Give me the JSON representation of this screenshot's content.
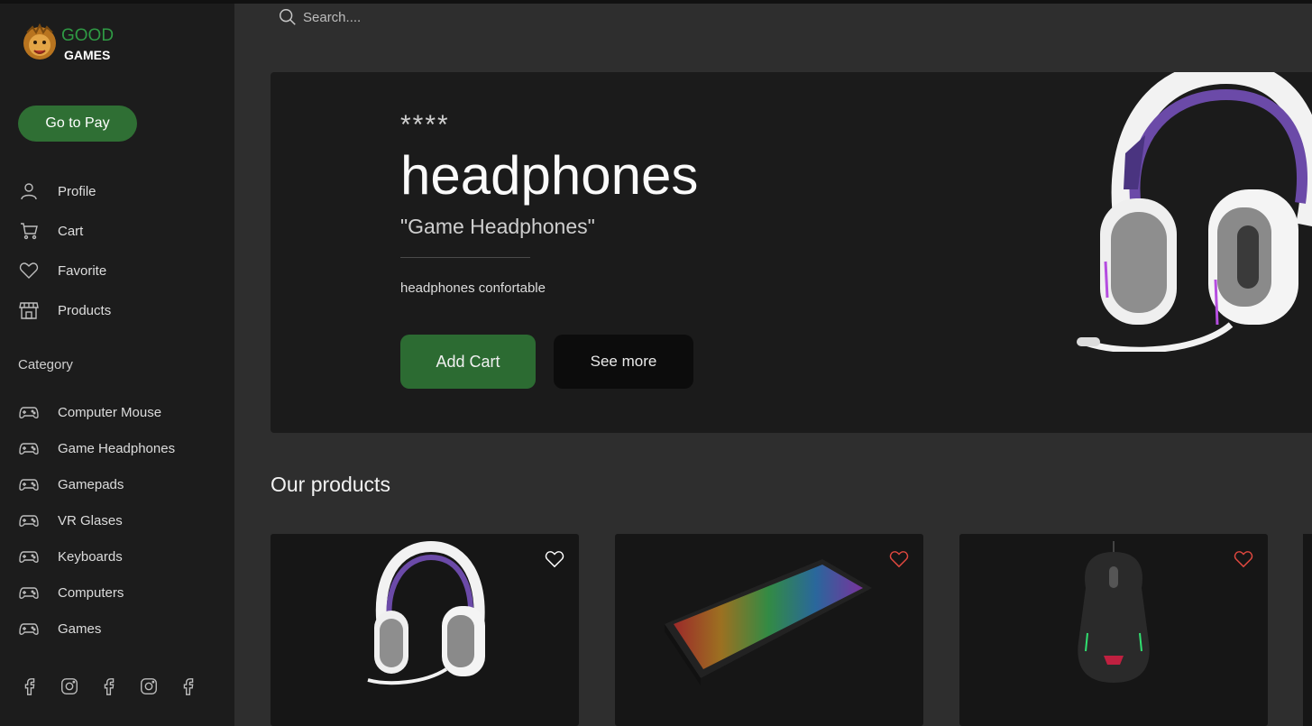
{
  "brand": {
    "line1": "GOOD",
    "line2": "GAMES"
  },
  "sidebar": {
    "go_to_pay": "Go to Pay",
    "nav": [
      {
        "label": "Profile",
        "icon": "user-icon"
      },
      {
        "label": "Cart",
        "icon": "cart-icon"
      },
      {
        "label": "Favorite",
        "icon": "heart-icon"
      },
      {
        "label": "Products",
        "icon": "store-icon"
      }
    ],
    "category_title": "Category",
    "categories": [
      {
        "label": "Computer Mouse",
        "icon": "gamepad-icon"
      },
      {
        "label": "Game Headphones",
        "icon": "gamepad-icon"
      },
      {
        "label": "Gamepads",
        "icon": "gamepad-icon"
      },
      {
        "label": "VR Glases",
        "icon": "gamepad-icon"
      },
      {
        "label": "Keyboards",
        "icon": "gamepad-icon"
      },
      {
        "label": "Computers",
        "icon": "gamepad-icon"
      },
      {
        "label": "Games",
        "icon": "gamepad-icon"
      }
    ],
    "social": [
      "facebook-icon",
      "instagram-icon",
      "facebook-icon",
      "instagram-icon",
      "facebook-icon"
    ]
  },
  "search": {
    "placeholder": "Search...."
  },
  "hero": {
    "stars": "****",
    "title": "headphones",
    "subtitle": "\"Game Headphones\"",
    "description": "headphones confortable",
    "add_cart": "Add Cart",
    "see_more": "See more"
  },
  "products": {
    "title": "Our products",
    "items": [
      {
        "name": "headphones",
        "favorite": false
      },
      {
        "name": "keyboard",
        "favorite": true
      },
      {
        "name": "mouse",
        "favorite": true
      }
    ]
  },
  "colors": {
    "accent": "#2f6f34",
    "brand_green": "#2f9a44",
    "heart_red": "#e0483f",
    "heart_white": "#ffffff"
  }
}
